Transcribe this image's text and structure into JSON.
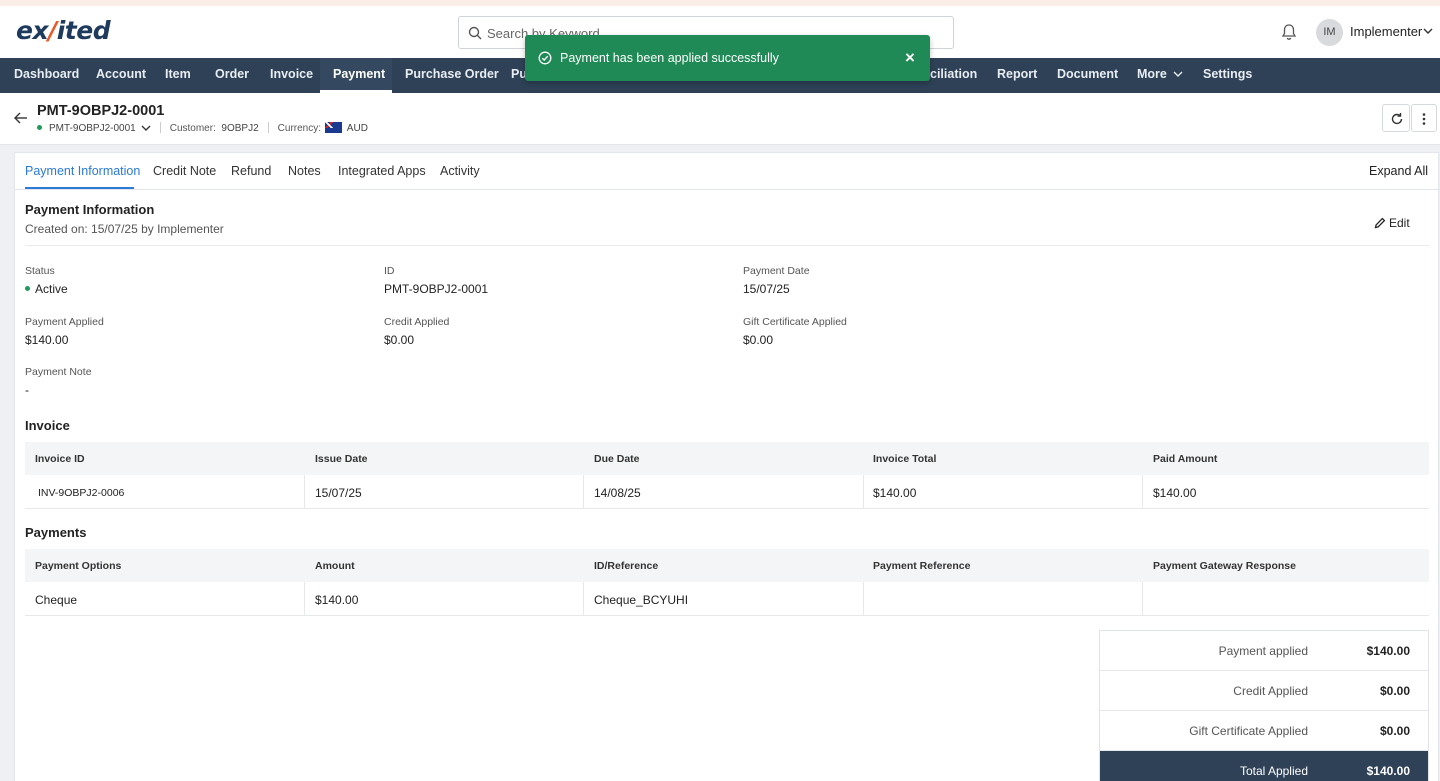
{
  "app": {
    "logo_part1": "ex",
    "logo_part2": "/",
    "logo_part3": "ited",
    "search_placeholder": "Search by Keyword",
    "user_initials": "IM",
    "user_name": "Implementer"
  },
  "nav": {
    "items": [
      "Dashboard",
      "Account",
      "Item",
      "Order",
      "Invoice",
      "Payment",
      "Purchase Order",
      "Pu",
      "ciliation",
      "Report",
      "Document",
      "More",
      "Settings"
    ],
    "active": "Payment"
  },
  "toast": {
    "message": "Payment has been applied successfully",
    "close": "×"
  },
  "record": {
    "title": "PMT-9OBPJ2-0001",
    "id_select": "PMT-9OBPJ2-0001",
    "customer_label": "Customer:",
    "customer": "9OBPJ2",
    "currency_label": "Currency:",
    "currency": "AUD"
  },
  "tabs": [
    "Payment Information",
    "Credit Note",
    "Refund",
    "Notes",
    "Integrated Apps",
    "Activity"
  ],
  "expand_all": "Expand All",
  "payment_info": {
    "title": "Payment Information",
    "created": "Created on: 15/07/25 by Implementer",
    "edit": "Edit",
    "fields": {
      "status_label": "Status",
      "status": "Active",
      "id_label": "ID",
      "id": "PMT-9OBPJ2-0001",
      "date_label": "Payment Date",
      "date": "15/07/25",
      "applied_label": "Payment Applied",
      "applied": "$140.00",
      "credit_label": "Credit Applied",
      "credit": "$0.00",
      "gift_label": "Gift Certificate Applied",
      "gift": "$0.00",
      "note_label": "Payment Note",
      "note": "-"
    }
  },
  "invoice_table": {
    "title": "Invoice",
    "headers": [
      "Invoice ID",
      "Issue Date",
      "Due Date",
      "Invoice Total",
      "Paid Amount"
    ],
    "rows": [
      [
        "INV-9OBPJ2-0006",
        "15/07/25",
        "14/08/25",
        "$140.00",
        "$140.00"
      ]
    ]
  },
  "payments_table": {
    "title": "Payments",
    "headers": [
      "Payment Options",
      "Amount",
      "ID/Reference",
      "Payment Reference",
      "Payment Gateway Response"
    ],
    "rows": [
      [
        "Cheque",
        "$140.00",
        "Cheque_BCYUHI",
        "",
        ""
      ]
    ]
  },
  "summary": {
    "rows": [
      {
        "label": "Payment applied",
        "value": "$140.00"
      },
      {
        "label": "Credit Applied",
        "value": "$0.00"
      },
      {
        "label": "Gift Certificate Applied",
        "value": "$0.00"
      },
      {
        "label": "Total Applied",
        "value": "$140.00"
      }
    ]
  },
  "colors": {
    "nav_bg": "#2e4156",
    "toast_bg": "#1f8a55",
    "accent": "#2a7ad6",
    "status_active": "#1f9a5a"
  }
}
